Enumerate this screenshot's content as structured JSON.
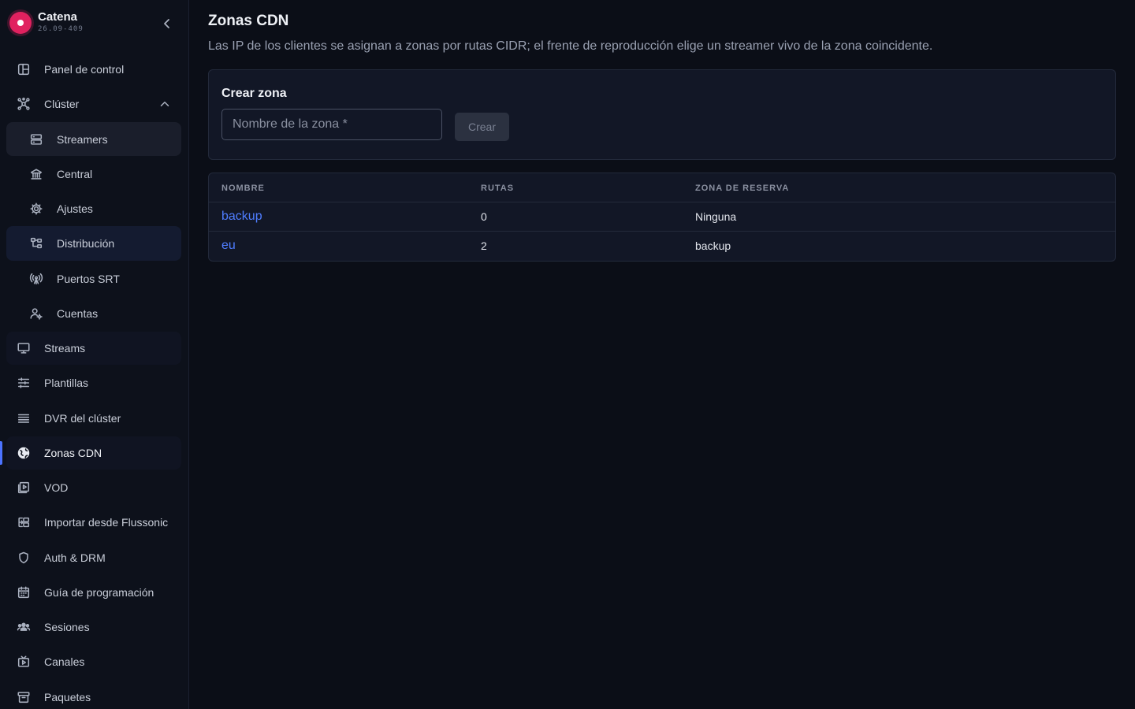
{
  "brand": {
    "name": "Catena",
    "version": "26.09-409"
  },
  "sidebar": {
    "items": [
      {
        "label": "Panel de control",
        "icon": "layout-dashboard-icon"
      },
      {
        "label": "Clúster",
        "icon": "cluster-network-icon",
        "expanded": true
      },
      {
        "label": "Streamers",
        "icon": "server-icon"
      },
      {
        "label": "Central",
        "icon": "bank-building-icon"
      },
      {
        "label": "Ajustes",
        "icon": "gear-icon"
      },
      {
        "label": "Distribución",
        "icon": "distribution-tree-icon"
      },
      {
        "label": "Puertos SRT",
        "icon": "antenna-icon"
      },
      {
        "label": "Cuentas",
        "icon": "user-accounts-icon"
      },
      {
        "label": "Streams",
        "icon": "monitor-icon"
      },
      {
        "label": "Plantillas",
        "icon": "sliders-icon"
      },
      {
        "label": "DVR del clúster",
        "icon": "list-stack-icon"
      },
      {
        "label": "Zonas CDN",
        "icon": "globe-icon",
        "active": true
      },
      {
        "label": "VOD",
        "icon": "video-library-icon"
      },
      {
        "label": "Importar desde Flussonic",
        "icon": "import-icon"
      },
      {
        "label": "Auth & DRM",
        "icon": "shield-icon"
      },
      {
        "label": "Guía de programación",
        "icon": "calendar-icon"
      },
      {
        "label": "Sesiones",
        "icon": "users-group-icon"
      },
      {
        "label": "Canales",
        "icon": "tv-icon"
      },
      {
        "label": "Paquetes",
        "icon": "archive-box-icon"
      }
    ]
  },
  "page": {
    "title": "Zonas CDN",
    "description": "Las IP de los clientes se asignan a zonas por rutas CIDR; el frente de reproducción elige un streamer vivo de la zona coincidente."
  },
  "create_form": {
    "title": "Crear zona",
    "placeholder": "Nombre de la zona *",
    "value": "",
    "button": "Crear"
  },
  "table": {
    "columns": [
      "NOMBRE",
      "RUTAS",
      "ZONA DE RESERVA"
    ],
    "rows": [
      {
        "name": "backup",
        "routes": "0",
        "fallback": "Ninguna"
      },
      {
        "name": "eu",
        "routes": "2",
        "fallback": "backup"
      }
    ]
  },
  "colors": {
    "background": "#0b0e17",
    "sidebar": "#0d111b",
    "accent": "#4c73ff",
    "link": "#4f7dff",
    "brand": "#e0215f"
  }
}
